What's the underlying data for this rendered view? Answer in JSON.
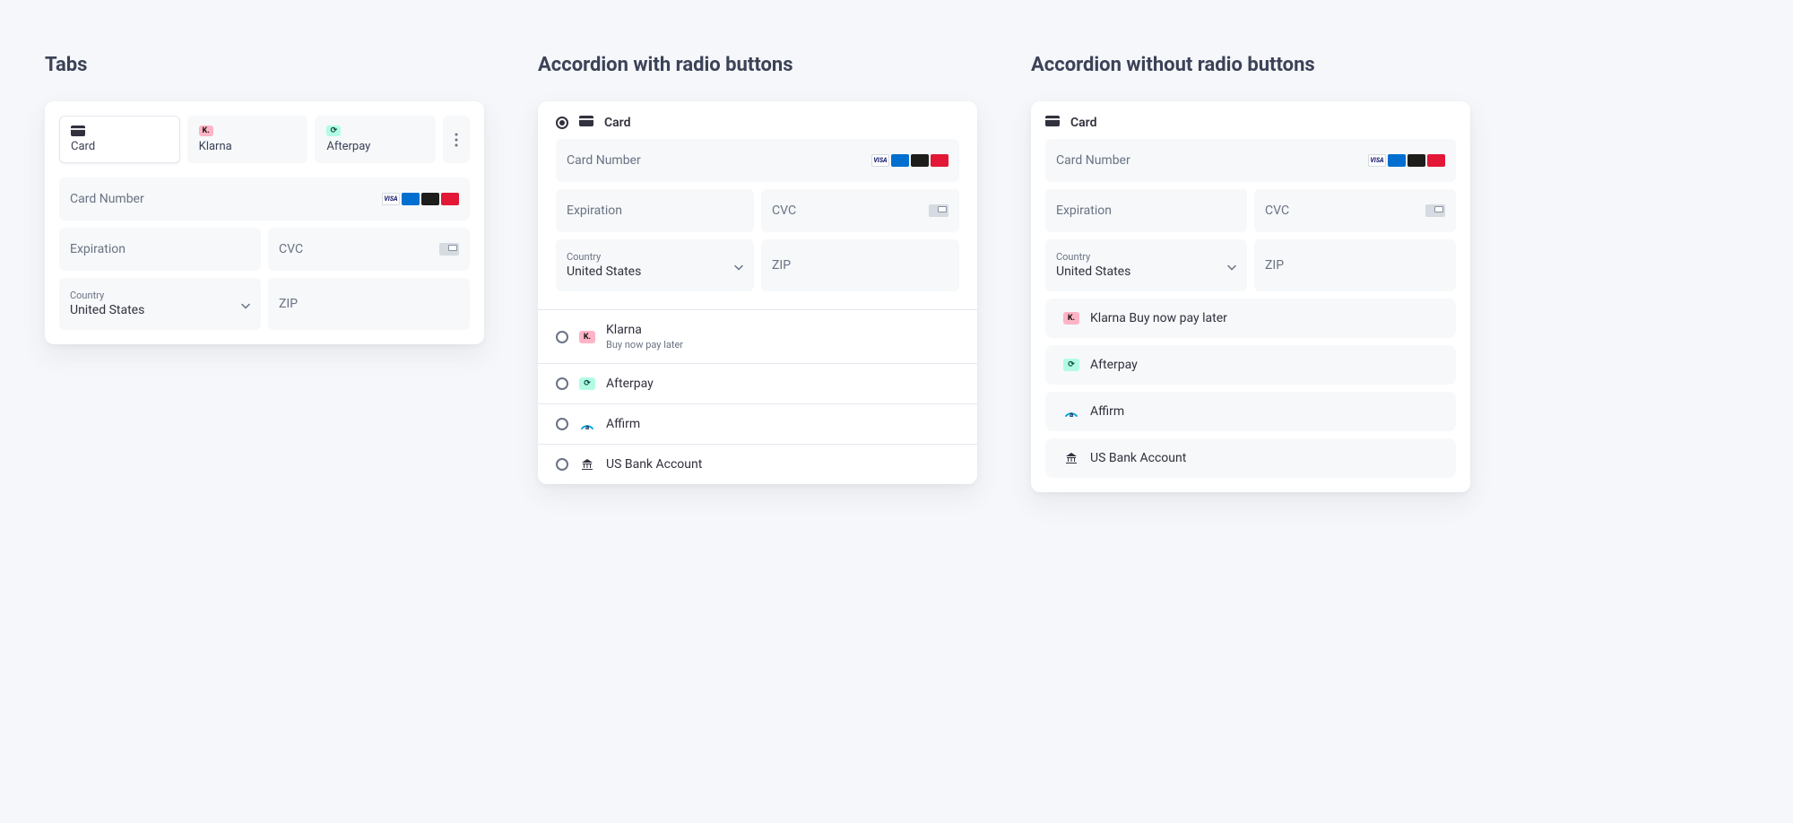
{
  "sections": {
    "tabs": "Tabs",
    "acc_radio": "Accordion with radio buttons",
    "acc_plain": "Accordion without radio buttons"
  },
  "methods": {
    "card": "Card",
    "klarna": "Klarna",
    "klarna_sub": "Buy now pay later",
    "afterpay": "Afterpay",
    "affirm": "Affirm",
    "us_bank": "US Bank Account"
  },
  "form": {
    "card_number": "Card Number",
    "expiration": "Expiration",
    "cvc": "CVC",
    "country_label": "Country",
    "country_value": "United States",
    "zip": "ZIP"
  }
}
